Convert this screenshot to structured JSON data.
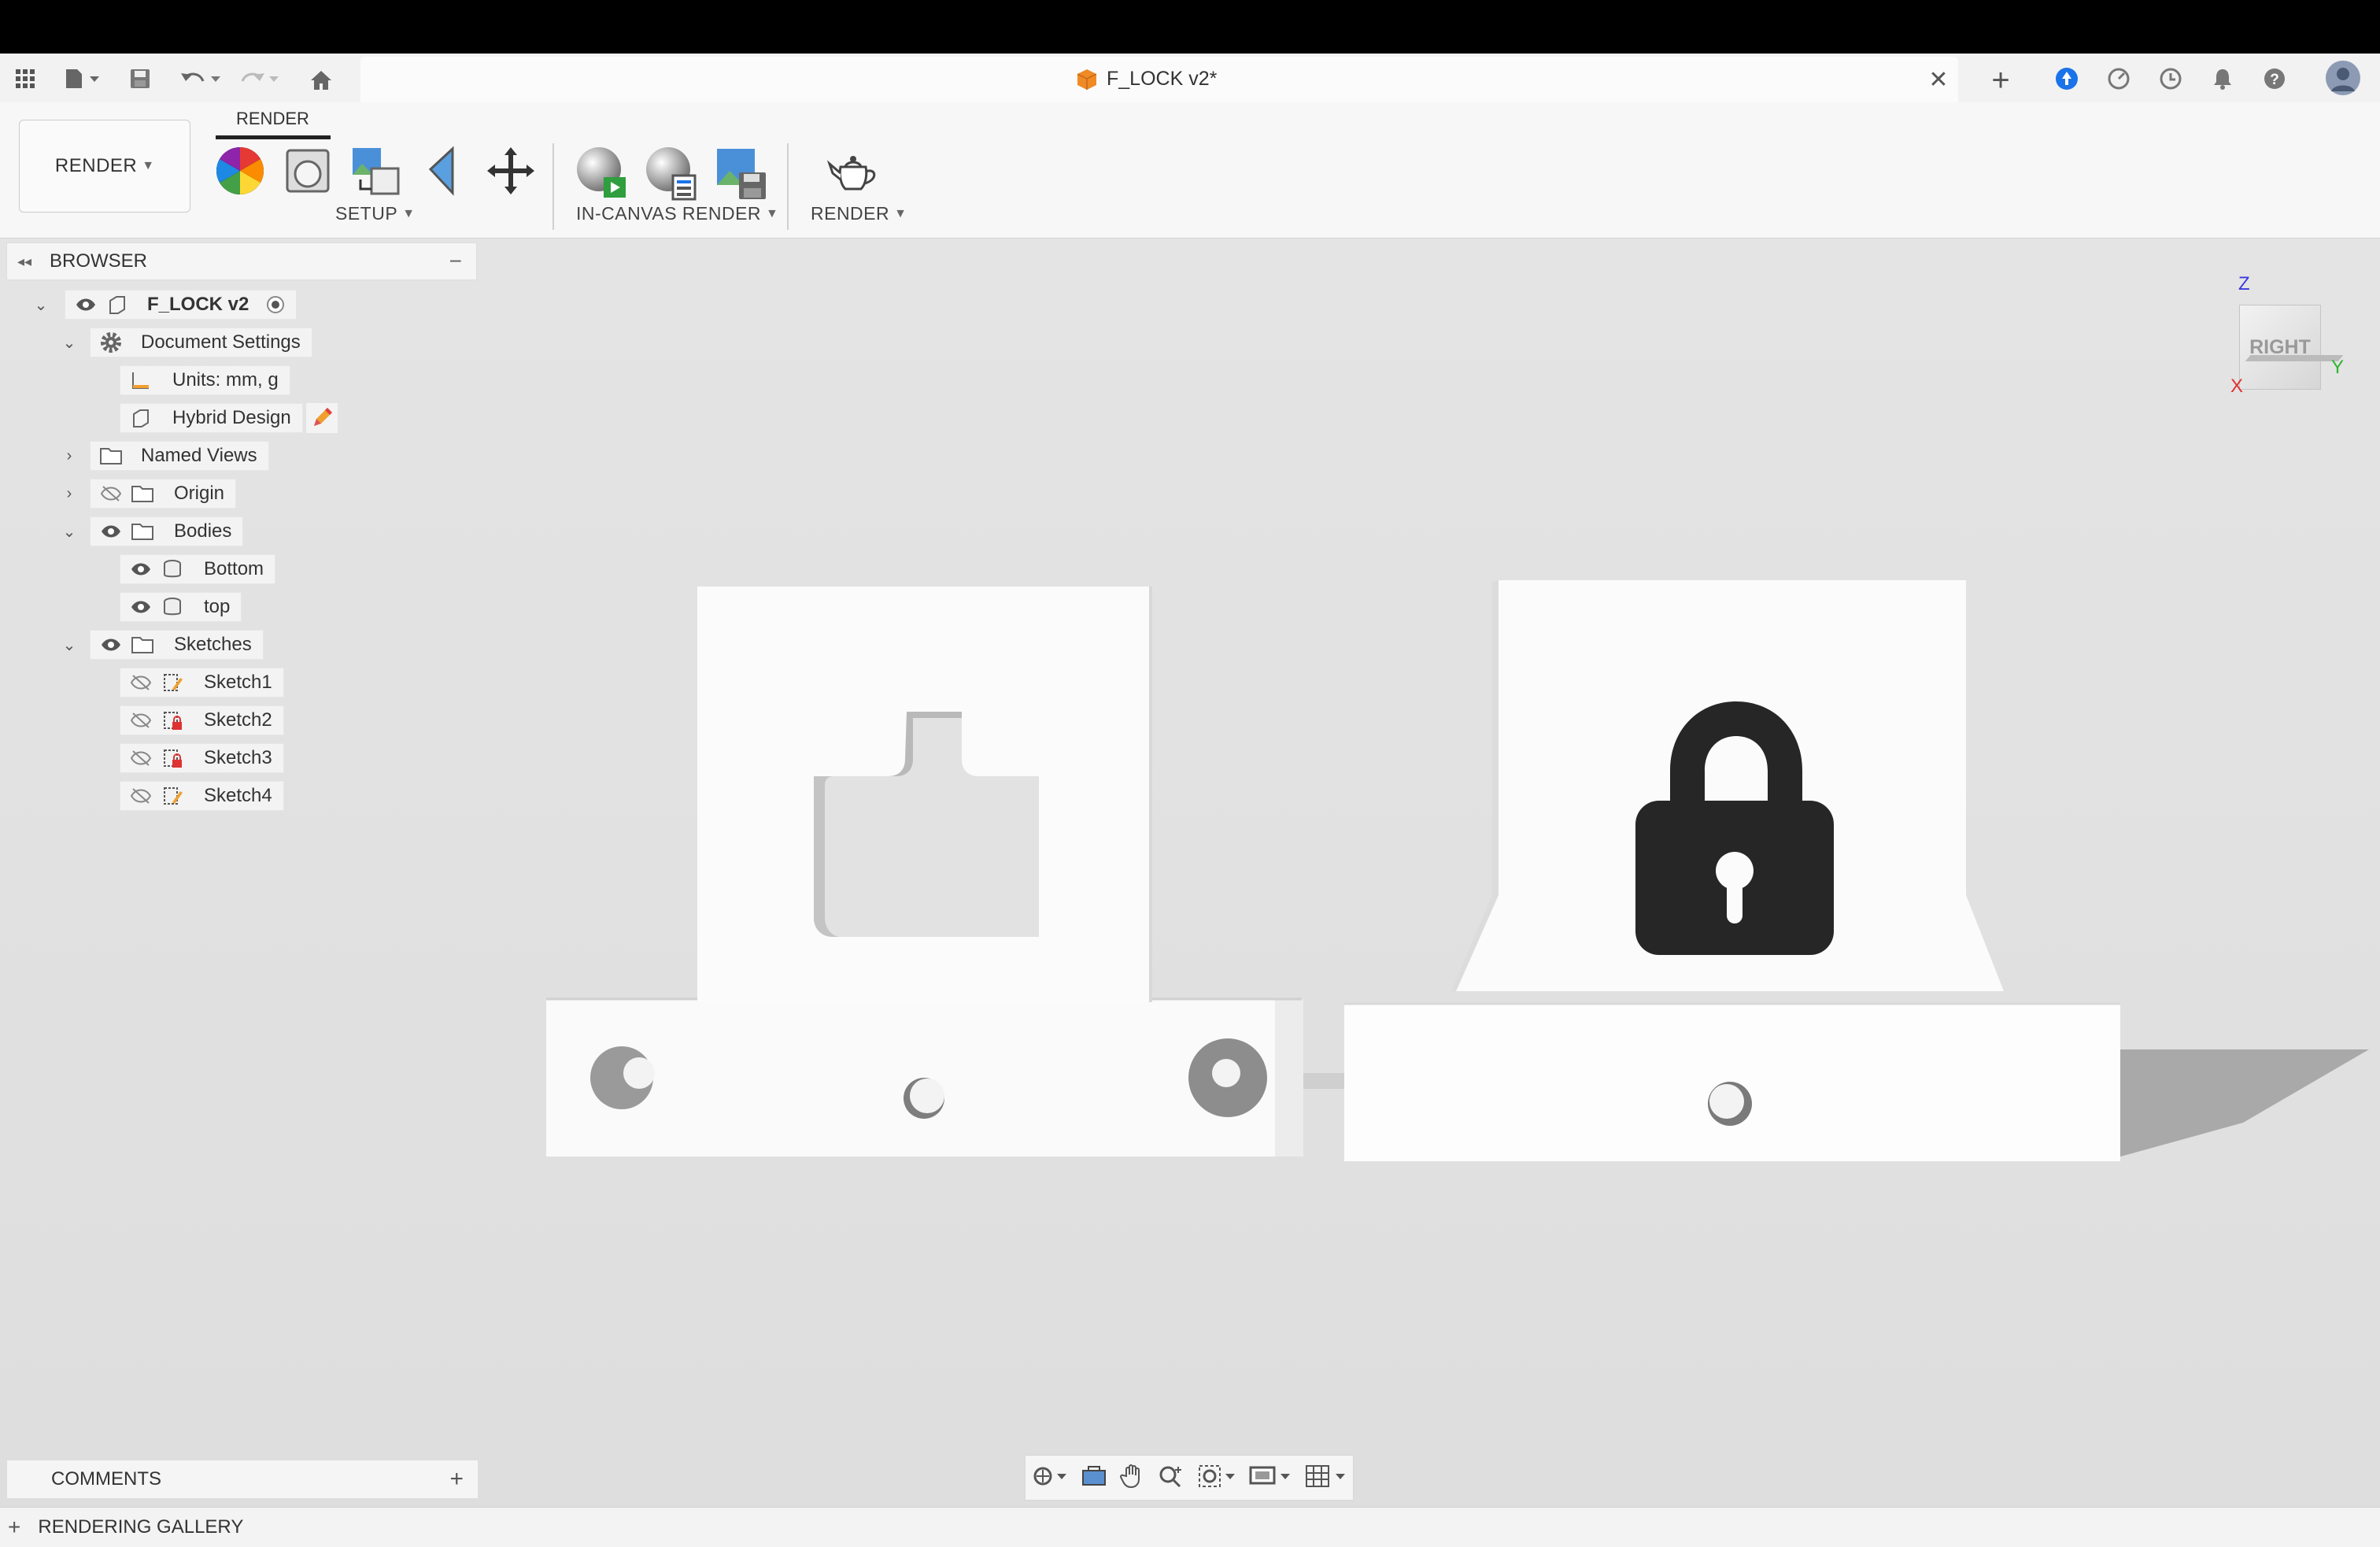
{
  "app": {
    "doc_title": "F_LOCK v2*"
  },
  "toolbar": {
    "workspace_label": "RENDER",
    "active_tab": "RENDER",
    "groups": [
      {
        "label": "SETUP"
      },
      {
        "label": "IN-CANVAS RENDER"
      },
      {
        "label": "RENDER"
      }
    ]
  },
  "browser": {
    "title": "BROWSER",
    "root": "F_LOCK v2",
    "items": [
      {
        "label": "Document Settings"
      },
      {
        "label": "Units: mm, g"
      },
      {
        "label": "Hybrid Design"
      },
      {
        "label": "Named Views"
      },
      {
        "label": "Origin"
      },
      {
        "label": "Bodies"
      },
      {
        "label": "Bottom"
      },
      {
        "label": "top"
      },
      {
        "label": "Sketches"
      },
      {
        "label": "Sketch1"
      },
      {
        "label": "Sketch2"
      },
      {
        "label": "Sketch3"
      },
      {
        "label": "Sketch4"
      }
    ]
  },
  "comments": {
    "label": "COMMENTS"
  },
  "gallery": {
    "label": "RENDERING GALLERY"
  },
  "viewcube": {
    "face": "RIGHT",
    "axis_z": "Z",
    "axis_y": "Y",
    "axis_x": "X"
  },
  "colors": {
    "accent": "#1a73e8",
    "doc_icon": "#f08a24",
    "axis_z": "#3a3ae0",
    "axis_y": "#2db52d",
    "axis_x": "#e03030"
  }
}
